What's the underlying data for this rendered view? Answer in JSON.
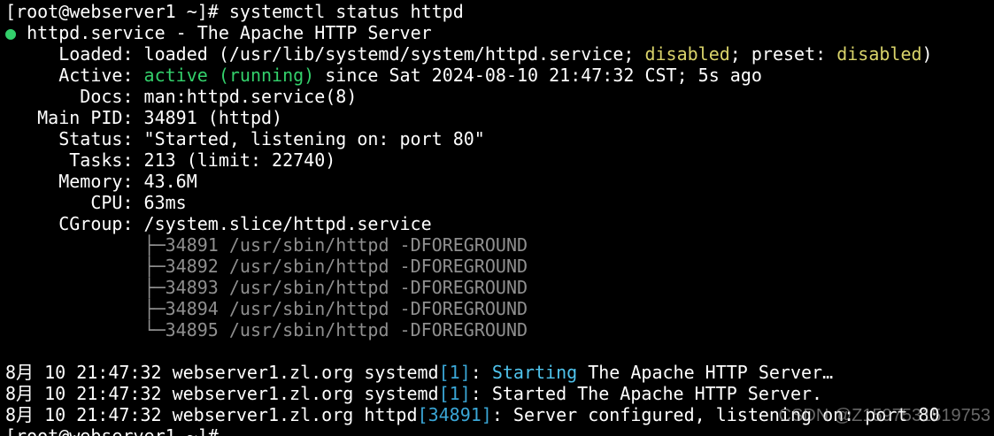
{
  "terminal": {
    "cmd_line": "[root@webserver1 ~]# systemctl status httpd",
    "bullet": "●",
    "service_title": " httpd.service - The Apache HTTP Server",
    "loaded_prefix": "     Loaded: loaded (/usr/lib/systemd/system/httpd.service; ",
    "loaded_state": "disabled",
    "loaded_mid": "; preset: ",
    "preset_state": "disabled",
    "loaded_suffix": ")",
    "active_prefix": "     Active: ",
    "active_state": "active (running)",
    "active_suffix": " since Sat 2024-08-10 21:47:32 CST; 5s ago",
    "docs": "       Docs: man:httpd.service(8)",
    "main_pid": "   Main PID: 34891 (httpd)",
    "status": "     Status: \"Started, listening on: port 80\"",
    "tasks": "      Tasks: 213 (limit: 22740)",
    "memory": "     Memory: 43.6M",
    "cpu": "        CPU: 63ms",
    "cgroup": "     CGroup: /system.slice/httpd.service",
    "cgroup_indent": "             ",
    "cgroup_procs": [
      "├─34891 /usr/sbin/httpd -DFOREGROUND",
      "├─34892 /usr/sbin/httpd -DFOREGROUND",
      "├─34893 /usr/sbin/httpd -DFOREGROUND",
      "├─34894 /usr/sbin/httpd -DFOREGROUND",
      "└─34895 /usr/sbin/httpd -DFOREGROUND"
    ],
    "log1_prefix": "8月 10 21:47:32 webserver1.zl.org systemd",
    "log1_pid": "[1]",
    "log1_sep": ": ",
    "log1_hl": "Starting",
    "log1_rest": " The Apache HTTP Server…",
    "log2_prefix": "8月 10 21:47:32 webserver1.zl.org systemd",
    "log2_pid": "[1]",
    "log2_rest": ": Started The Apache HTTP Server.",
    "log3_prefix": "8月 10 21:47:32 webserver1.zl.org httpd",
    "log3_pid": "[34891]",
    "log3_rest": ": Server configured, listening on: port 80",
    "prompt": "[root@webserver1 ~]#"
  },
  "watermark": "CSDN @Z1597531519753",
  "colors": {
    "background": "#000000",
    "text": "#ffffff",
    "active_green": "#33d06b",
    "disabled_yellow": "#d9d36a",
    "process_gray": "#8f8f8f",
    "pid_blue": "#3aa6d6"
  }
}
